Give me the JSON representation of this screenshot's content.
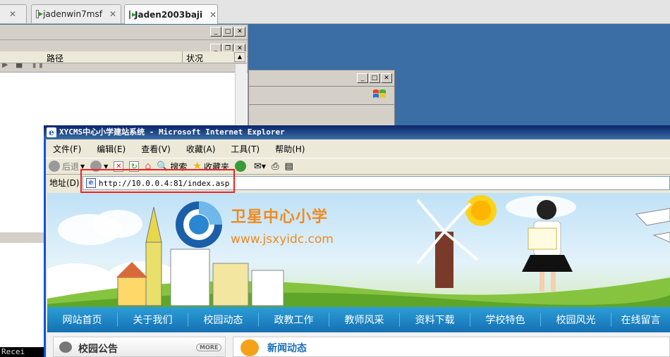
{
  "tabs": [
    {
      "label": ""
    },
    {
      "label": "jadenwin7msf"
    },
    {
      "label": "Jaden2003baji"
    }
  ],
  "console": {
    "columns": [
      "路径",
      "状况"
    ],
    "status_text": "Recei"
  },
  "ie": {
    "title": "XYCMS中心小学建站系统 - Microsoft Internet Explorer",
    "menu": [
      "文件(F)",
      "编辑(E)",
      "查看(V)",
      "收藏(A)",
      "工具(T)",
      "帮助(H)"
    ],
    "toolbar": {
      "back": "后退",
      "search": "搜索",
      "favorites": "收藏夹"
    },
    "address_label": "地址(D)",
    "url": "http://10.0.0.4:81/index.asp"
  },
  "site": {
    "school_name": "卫星中心小学",
    "domain": "www.jsxyidc.com",
    "nav": [
      "网站首页",
      "关于我们",
      "校园动态",
      "政教工作",
      "教师风采",
      "资料下载",
      "学校特色",
      "校园风光",
      "在线留言"
    ],
    "notice_title": "校园公告",
    "more_label": "MORE",
    "news_title": "新闻动态"
  },
  "colors": {
    "ie_title": "#0a246a",
    "nav": "#1a86c8",
    "brand": "#f08a1e",
    "highlight": "#e22222"
  }
}
